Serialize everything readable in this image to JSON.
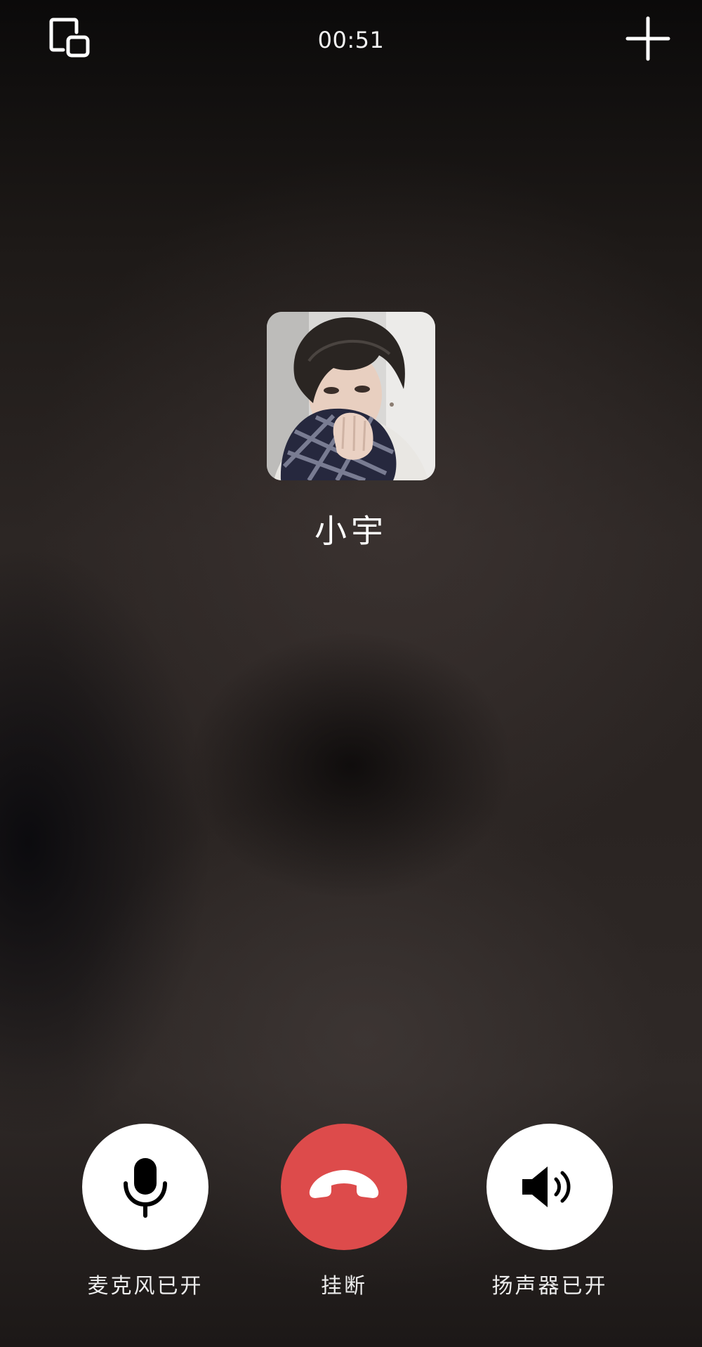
{
  "call": {
    "timer": "00:51",
    "caller_name": "小宇"
  },
  "controls": {
    "mic_label": "麦克风已开",
    "hangup_label": "挂断",
    "speaker_label": "扬声器已开"
  },
  "icons": {
    "top_left": "picture-in-picture-icon",
    "top_right": "plus-icon",
    "mic": "microphone-icon",
    "hangup": "phone-hangup-icon",
    "speaker": "speaker-icon"
  },
  "colors": {
    "hangup_red": "#dd4b4b",
    "button_white": "#ffffff",
    "text": "#ffffff"
  }
}
